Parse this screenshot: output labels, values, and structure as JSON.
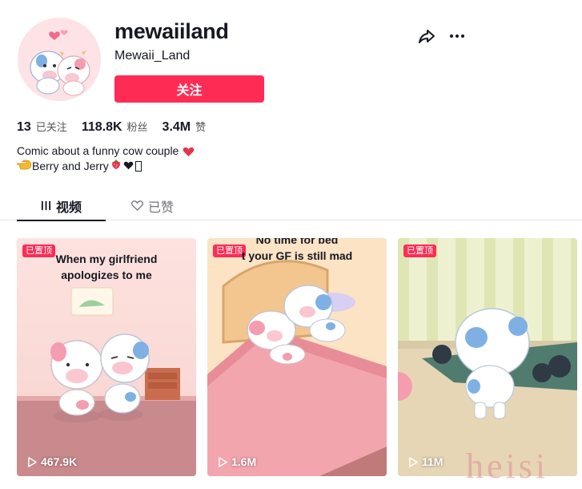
{
  "profile": {
    "username": "mewaiiland",
    "handle": "Mewaii_Land",
    "follow_label": "关注",
    "stats": [
      {
        "value": "13",
        "label": "已关注"
      },
      {
        "value": "118.8K",
        "label": "粉丝"
      },
      {
        "value": "3.4M",
        "label": "赞"
      }
    ],
    "bio_line1": "Comic about a funny cow couple",
    "bio_line2": "Berry and Jerry"
  },
  "tabs": {
    "videos_label": "视频",
    "liked_label": "已赞"
  },
  "videos": [
    {
      "pinned_label": "已置顶",
      "caption_line1": "When my girlfriend",
      "caption_line2": "apologizes to me",
      "views": "467.9K"
    },
    {
      "pinned_label": "已置顶",
      "caption_line1": "No time for bed",
      "caption_line2": "t your GF is still mad",
      "views": "1.6M"
    },
    {
      "pinned_label": "已置顶",
      "views": "11M"
    }
  ],
  "watermark": "heisi",
  "colors": {
    "accent": "#fe2c55",
    "text": "#161823",
    "muted": "#73747b"
  }
}
